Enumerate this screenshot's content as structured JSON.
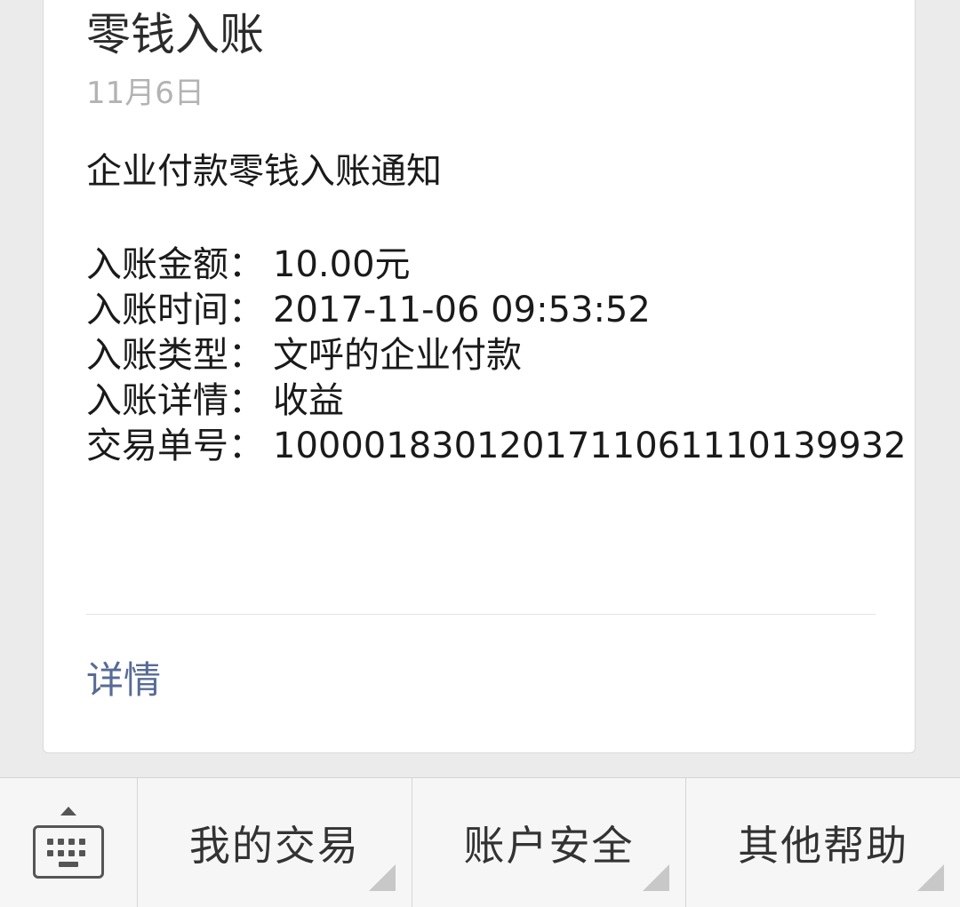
{
  "message": {
    "title": "零钱入账",
    "date": "11月6日",
    "heading": "企业付款零钱入账通知",
    "fields": [
      {
        "label": "入账金额：",
        "value": "10.00元"
      },
      {
        "label": "入账时间：",
        "value": "2017-11-06 09:53:52"
      },
      {
        "label": "入账类型：",
        "value": "文呼的企业付款"
      },
      {
        "label": "入账详情：",
        "value": "收益"
      },
      {
        "label": "交易单号：",
        "value": "1000018301201711061110139932"
      }
    ],
    "detail_link": "详情"
  },
  "bottom_menu": {
    "keyboard_icon": "keyboard-icon",
    "items": [
      {
        "label": "我的交易"
      },
      {
        "label": "账户安全"
      },
      {
        "label": "其他帮助"
      }
    ]
  },
  "colors": {
    "background": "#ebebeb",
    "card": "#ffffff",
    "link": "#576b95",
    "date": "#b3b3b3"
  }
}
